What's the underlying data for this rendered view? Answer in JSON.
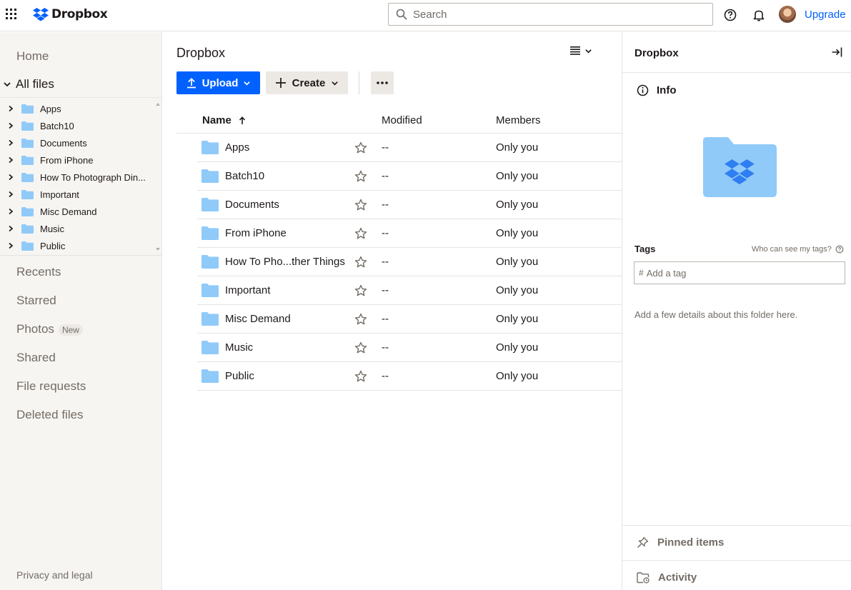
{
  "app": {
    "name": "Dropbox"
  },
  "header": {
    "search_placeholder": "Search",
    "upgrade_label": "Upgrade",
    "icons": [
      "grid-icon",
      "dropbox-logo",
      "search-icon",
      "help-icon",
      "bell-icon",
      "avatar"
    ]
  },
  "sidebar": {
    "home": "Home",
    "all_files": "All files",
    "tree": [
      {
        "label": "Apps"
      },
      {
        "label": "Batch10"
      },
      {
        "label": "Documents"
      },
      {
        "label": "From iPhone"
      },
      {
        "label": "How To Photograph Din..."
      },
      {
        "label": "Important"
      },
      {
        "label": "Misc Demand"
      },
      {
        "label": "Music"
      },
      {
        "label": "Public"
      }
    ],
    "recents": "Recents",
    "starred": "Starred",
    "photos": "Photos",
    "photos_badge": "New",
    "shared": "Shared",
    "file_requests": "File requests",
    "deleted_files": "Deleted files",
    "privacy": "Privacy and legal"
  },
  "main": {
    "title": "Dropbox",
    "upload_label": "Upload",
    "create_label": "Create",
    "columns": {
      "name": "Name",
      "modified": "Modified",
      "members": "Members"
    },
    "rows": [
      {
        "name": "Apps",
        "modified": "--",
        "members": "Only you"
      },
      {
        "name": "Batch10",
        "modified": "--",
        "members": "Only you"
      },
      {
        "name": "Documents",
        "modified": "--",
        "members": "Only you"
      },
      {
        "name": "From iPhone",
        "modified": "--",
        "members": "Only you"
      },
      {
        "name": "How To Pho...ther Things",
        "modified": "--",
        "members": "Only you"
      },
      {
        "name": "Important",
        "modified": "--",
        "members": "Only you"
      },
      {
        "name": "Misc Demand",
        "modified": "--",
        "members": "Only you"
      },
      {
        "name": "Music",
        "modified": "--",
        "members": "Only you"
      },
      {
        "name": "Public",
        "modified": "--",
        "members": "Only you"
      }
    ]
  },
  "details": {
    "title": "Dropbox",
    "info_label": "Info",
    "tags_label": "Tags",
    "tags_help": "Who can see my tags?",
    "tag_placeholder": "Add a tag",
    "description_prompt": "Add a few details about this folder here.",
    "pinned_label": "Pinned items",
    "activity_label": "Activity"
  },
  "colors": {
    "accent": "#0061fe",
    "folder": "#90caf9",
    "sidebar_bg": "#f7f5f2"
  }
}
